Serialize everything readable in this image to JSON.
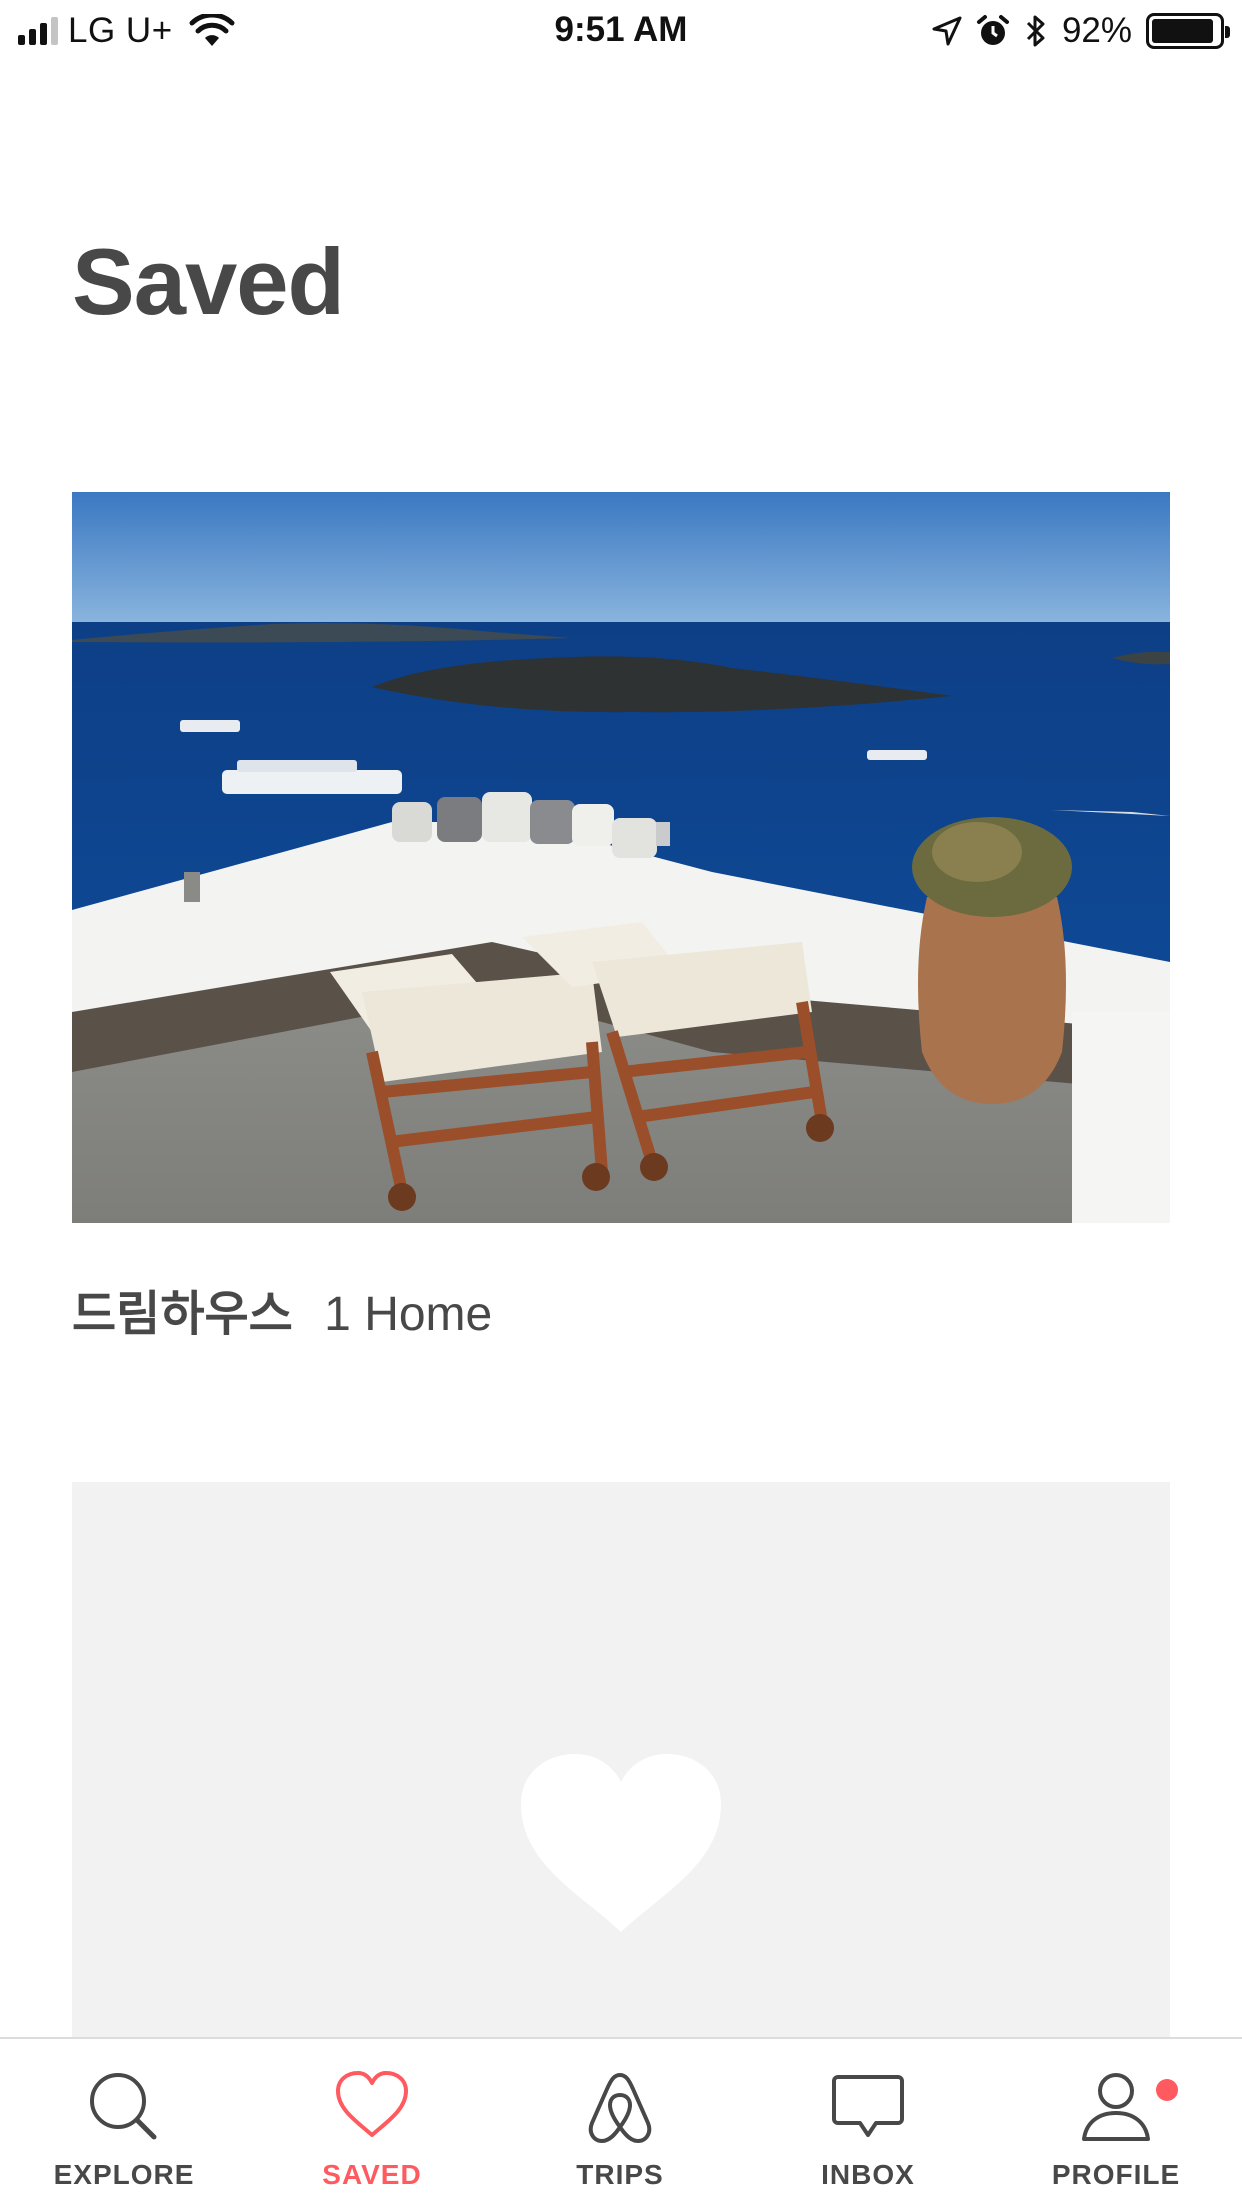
{
  "status_bar": {
    "carrier": "LG U+",
    "time": "9:51 AM",
    "battery": "92%",
    "battery_level": 0.92,
    "signal_bars": 3,
    "icons": [
      "signal-icon",
      "wifi-icon",
      "location-arrow-icon",
      "alarm-icon",
      "bluetooth-icon",
      "battery-icon"
    ]
  },
  "header": {
    "title": "Saved"
  },
  "wishlists": [
    {
      "name": "드림하우스",
      "count": "1 Home",
      "image": "santorini-terrace-photo"
    },
    {
      "image": "empty-heart-placeholder"
    }
  ],
  "tab_bar": {
    "tabs": [
      {
        "label": "EXPLORE",
        "icon": "search-icon"
      },
      {
        "label": "SAVED",
        "icon": "heart-icon",
        "active": true
      },
      {
        "label": "TRIPS",
        "icon": "airbnb-logo-icon"
      },
      {
        "label": "INBOX",
        "icon": "chat-icon"
      },
      {
        "label": "PROFILE",
        "icon": "profile-icon",
        "badge": true
      }
    ]
  },
  "colors": {
    "accent": "#ff5a5f",
    "text": "#484848",
    "placeholder_bg": "#f2f2f2"
  }
}
